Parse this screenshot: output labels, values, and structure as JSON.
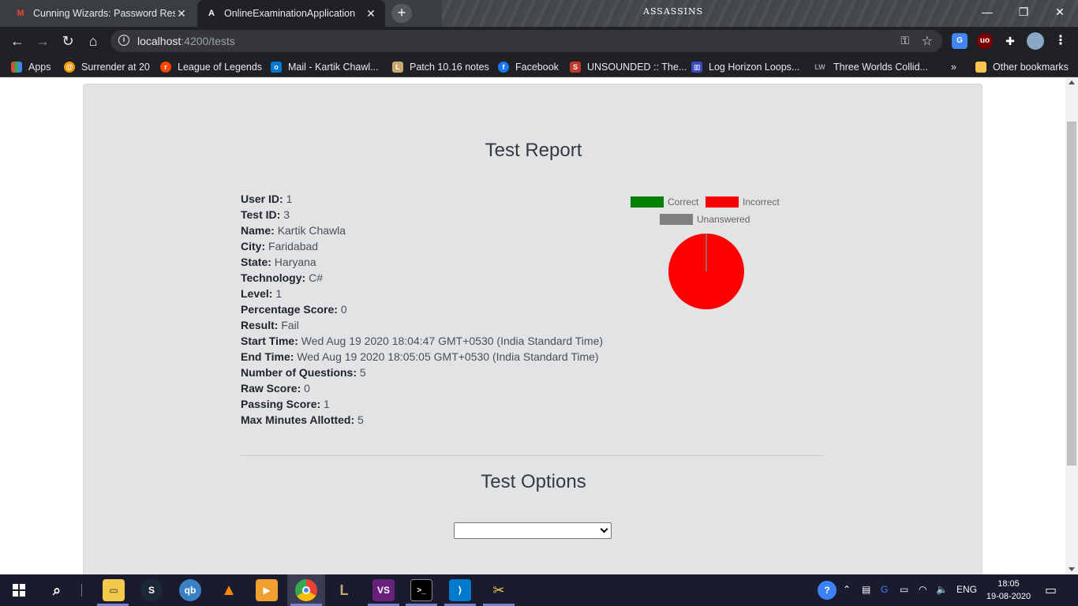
{
  "browser": {
    "tabs": [
      {
        "title": "Cunning Wizards: Password Rese",
        "icon": "gmail-icon",
        "active": false
      },
      {
        "title": "OnlineExaminationApplication",
        "icon": "angular-icon",
        "active": true
      }
    ],
    "new_tab": "+",
    "theme_logo": "ASSASSINS",
    "address": {
      "host": "localhost",
      "path": ":4200/tests"
    },
    "bookmarks": [
      {
        "label": "Apps",
        "icon": "apps-grid-icon",
        "color": "#e8453c"
      },
      {
        "label": "Surrender at 20",
        "icon": "surrender-icon",
        "color": "#f29900"
      },
      {
        "label": "League of Legends",
        "icon": "reddit-icon",
        "color": "#ff4500"
      },
      {
        "label": "Mail - Kartik Chawl...",
        "icon": "outlook-icon",
        "color": "#0078d4"
      },
      {
        "label": "Patch 10.16 notes",
        "icon": "league-icon",
        "color": "#c8aa6e"
      },
      {
        "label": "Facebook",
        "icon": "facebook-icon",
        "color": "#1877f2"
      },
      {
        "label": "UNSOUNDED :: The...",
        "icon": "unsounded-icon",
        "color": "#c0392b"
      },
      {
        "label": "Log Horizon Loops...",
        "icon": "building-icon",
        "color": "#3b4cc0"
      },
      {
        "label": "Three Worlds Collid...",
        "icon": "lw-icon",
        "color": "#202124"
      }
    ],
    "bookmarks_overflow": "»",
    "other_bookmarks": "Other bookmarks"
  },
  "report": {
    "title": "Test Report",
    "fields": [
      {
        "label": "User ID:",
        "value": "1"
      },
      {
        "label": "Test ID:",
        "value": "3"
      },
      {
        "label": "Name:",
        "value": "Kartik Chawla"
      },
      {
        "label": "City:",
        "value": "Faridabad"
      },
      {
        "label": "State:",
        "value": "Haryana"
      },
      {
        "label": "Technology:",
        "value": "C#"
      },
      {
        "label": "Level:",
        "value": "1"
      },
      {
        "label": "Percentage Score:",
        "value": "0"
      },
      {
        "label": "Result:",
        "value": "Fail"
      },
      {
        "label": "Start Time:",
        "value": "Wed Aug 19 2020 18:04:47 GMT+0530 (India Standard Time)"
      },
      {
        "label": "End Time:",
        "value": "Wed Aug 19 2020 18:05:05 GMT+0530 (India Standard Time)"
      },
      {
        "label": "Number of Questions:",
        "value": "5"
      },
      {
        "label": "Raw Score:",
        "value": "0"
      },
      {
        "label": "Passing Score:",
        "value": "1"
      },
      {
        "label": "Max Minutes Allotted:",
        "value": "5"
      }
    ]
  },
  "chart_data": {
    "type": "pie",
    "categories": [
      "Correct",
      "Incorrect",
      "Unanswered"
    ],
    "values": [
      0,
      5,
      0
    ],
    "colors": [
      "#008000",
      "#ff0000",
      "#808080"
    ],
    "legend": "top"
  },
  "options": {
    "title": "Test Options",
    "selected": ""
  },
  "taskbar": {
    "apps": [
      "file-explorer-icon",
      "steam-icon",
      "qbittorrent-icon",
      "vlc-icon",
      "media-player-icon",
      "chrome-icon",
      "league-client-icon",
      "visual-studio-icon",
      "terminal-icon",
      "vscode-icon",
      "tools-icon"
    ],
    "language": "ENG",
    "time": "18:05",
    "date": "19-08-2020"
  }
}
